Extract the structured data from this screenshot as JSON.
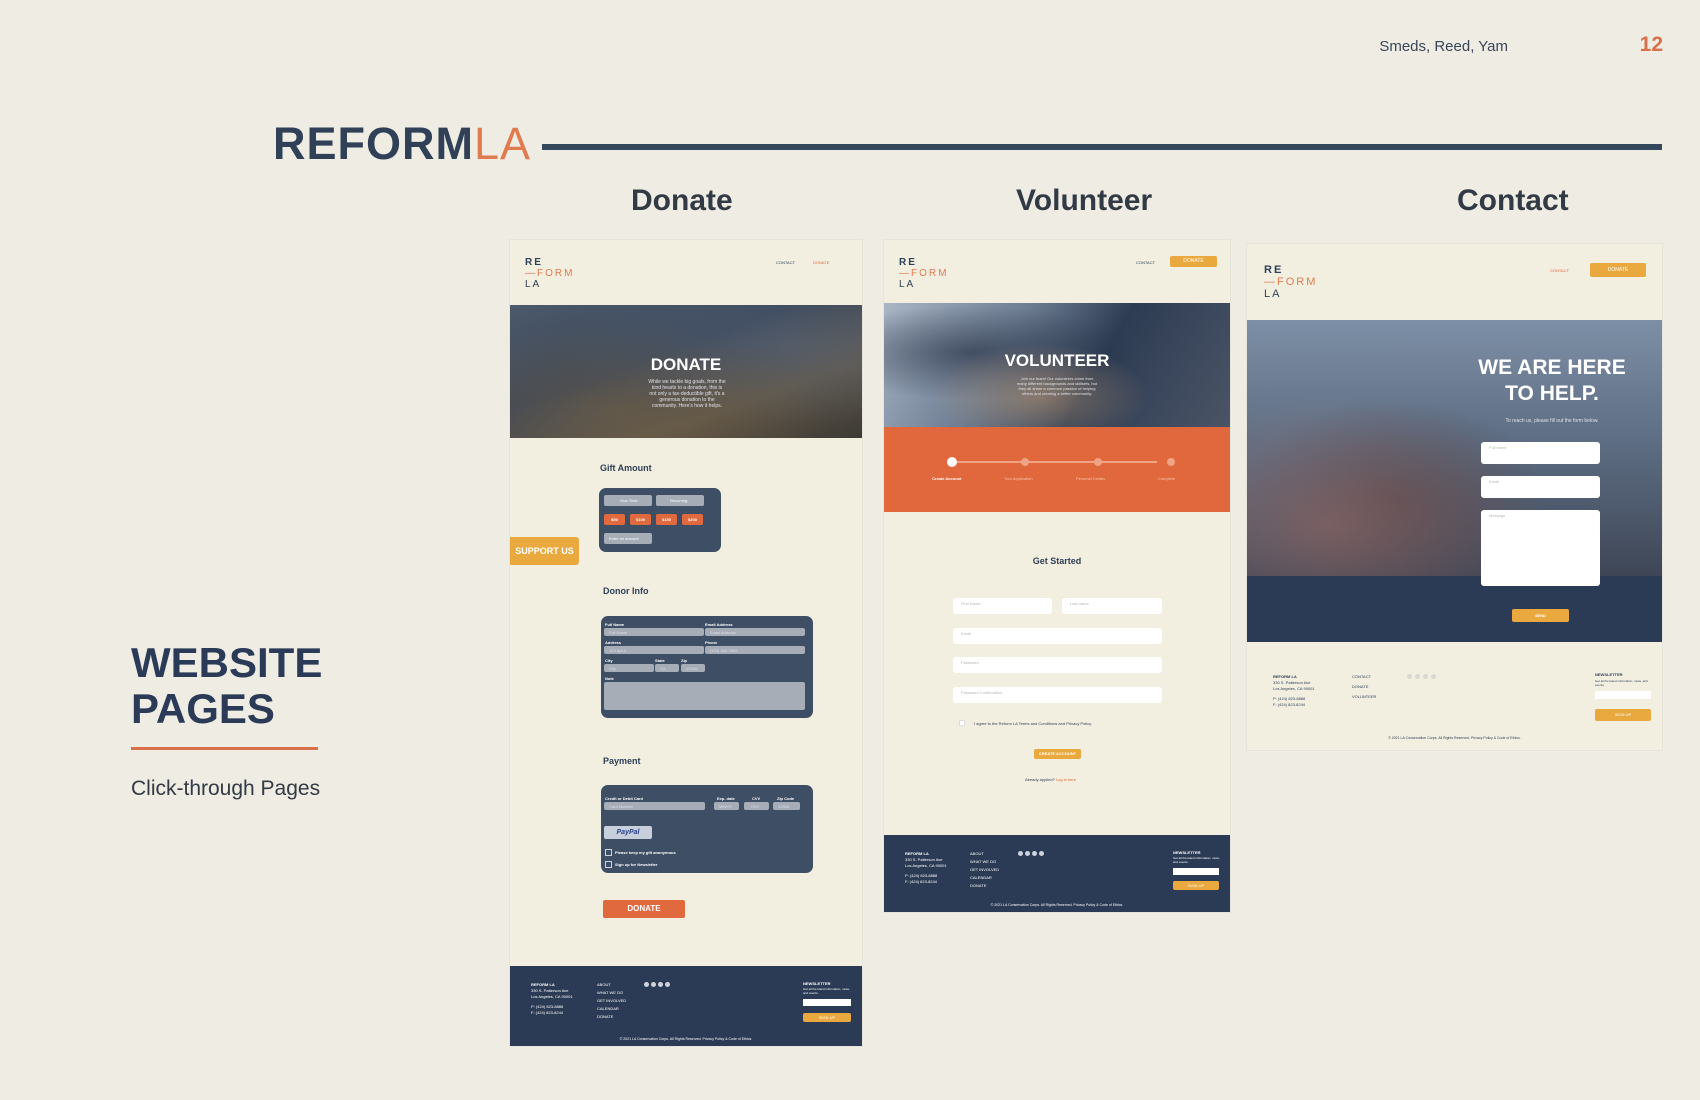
{
  "header": {
    "authors": "Smeds, Reed, Yam",
    "page_number": "12"
  },
  "brand": {
    "part1": "REFORM",
    "part2": "LA"
  },
  "columns": {
    "donate": "Donate",
    "volunteer": "Volunteer",
    "contact": "Contact"
  },
  "section": {
    "title": "WEBSITE PAGES",
    "subtitle": "Click-through Pages"
  },
  "site_logo": {
    "line1": "RE",
    "line2": "—FORM",
    "line3": "LA"
  },
  "site_nav": {
    "contact": "CONTACT",
    "donate": "DONATE"
  },
  "donate_page": {
    "hero_title": "DONATE",
    "hero_text": "While we tackle big goals, from the kind hearts to a donation, this is not only a tax-deductible gift, it's a generous donation to the community. Here's how it helps.",
    "gift_amount_label": "Gift Amount",
    "gift_tabs": [
      "One-Time",
      "Recurring"
    ],
    "amounts": [
      "$50",
      "$100",
      "$150",
      "$200"
    ],
    "other_amount": "Enter an amount",
    "support_tab": "SUPPORT US",
    "donor_info_label": "Donor Info",
    "donor_fields": [
      {
        "label": "Full Name",
        "placeholder": "Full Name"
      },
      {
        "label": "Email Address",
        "placeholder": "Email Address"
      },
      {
        "label": "Address",
        "placeholder": "123 Apt A"
      },
      {
        "label": "Phone",
        "placeholder": "(123) 456-7890"
      },
      {
        "label": "City",
        "placeholder": "City"
      },
      {
        "label": "State",
        "placeholder": "CA"
      },
      {
        "label": "Zip",
        "placeholder": "12345"
      },
      {
        "label": "Note",
        "placeholder": ""
      }
    ],
    "payment_label": "Payment",
    "payment_fields": [
      {
        "label": "Credit or Debit Card",
        "placeholder": "Card Number"
      },
      {
        "label": "Exp. date",
        "placeholder": "MM/YY"
      },
      {
        "label": "CVV",
        "placeholder": "CVV"
      },
      {
        "label": "Zip Code",
        "placeholder": "12345"
      }
    ],
    "paypal": "PayPal",
    "check_anonymous": "Please keep my gift anonymous",
    "check_newsletter": "Sign up for Newsletter",
    "donate_button": "DONATE"
  },
  "volunteer_page": {
    "hero_title": "VOLUNTEER",
    "hero_text": "Join our team! Our volunteers come from many different backgrounds and skillsets, but they all share a common passion of helping others and creating a better community.",
    "steps": [
      "Create Account",
      "Your Application",
      "Personal Details",
      "Complete"
    ],
    "get_started": "Get Started",
    "fields": [
      "First Name",
      "Last name",
      "Email",
      "Password",
      "Password Confirmation"
    ],
    "agree": "I agree to the Reform LA Terms and Conditions and Privacy Policy.",
    "create_button": "CREATE ACCOUNT",
    "already": "Already applied?",
    "login": "Log in here"
  },
  "contact_page": {
    "hero_title_1": "WE ARE HERE",
    "hero_title_2": "TO HELP.",
    "hero_text": "To reach us, please fill out the form below.",
    "fields": [
      "Full name",
      "Email",
      "Message"
    ],
    "send_button": "SEND"
  },
  "footer": {
    "org": "REFORM LA",
    "address1": "330 S. Patterson Ave",
    "address2": "Los Angeles, CA 90001",
    "phone": "P: (424) 823-8888",
    "fax": "F: (424) 823-8244",
    "links": [
      "ABOUT",
      "WHAT WE DO",
      "GET INVOLVED",
      "CALENDAR",
      "DONATE"
    ],
    "contact_links": [
      "CONTACT",
      "DONATE",
      "VOLUNTEER"
    ],
    "newsletter": "NEWSLETTER",
    "newsletter_text": "Get all the latest information, news, and events.",
    "signup": "SIGN UP",
    "copyright": "© 2021 LA Conservation Corps. All Rights Reserved. Privacy Policy & Code of Ethics."
  },
  "colors": {
    "navy": "#2c3b55",
    "orange": "#e06a3d",
    "gold": "#e9a93e",
    "cream": "#f2efe1"
  }
}
